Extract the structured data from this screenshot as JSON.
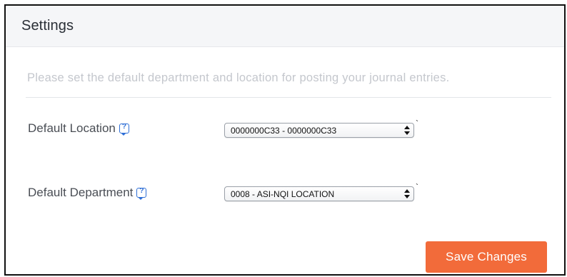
{
  "header": {
    "title": "Settings"
  },
  "description": "Please set the default department and location for posting your journal entries.",
  "fields": {
    "location": {
      "label": "Default Location",
      "selected": "0000000C33 - 0000000C33"
    },
    "department": {
      "label": "Default Department",
      "selected": "0008 - ASI-NQI LOCATION"
    }
  },
  "actions": {
    "save_label": "Save Changes"
  },
  "colors": {
    "accent": "#f26b3a",
    "help_icon": "#2f6fd6",
    "header_bg": "#f5f6f8"
  }
}
